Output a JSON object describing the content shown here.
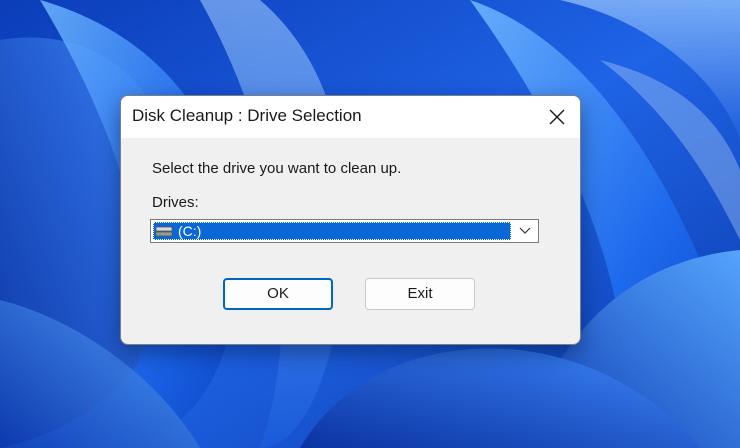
{
  "dialog": {
    "title": "Disk Cleanup : Drive Selection",
    "prompt": "Select the drive you want to clean up.",
    "drives_label": "Drives:",
    "selected_drive": "(C:)",
    "ok_label": "OK",
    "exit_label": "Exit",
    "icons": {
      "close": "close-icon",
      "drive": "drive-icon",
      "dropdown": "chevron-down-icon"
    }
  },
  "colors": {
    "selection": "#0a67d6",
    "wallpaper_base": "#1f63e6",
    "default_button_border": "#0067c0"
  }
}
